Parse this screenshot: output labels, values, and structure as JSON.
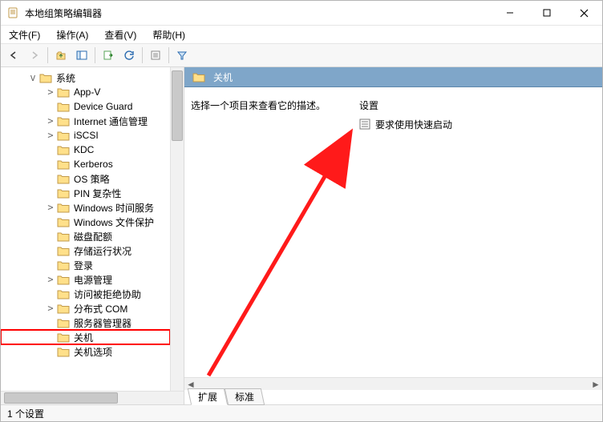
{
  "window": {
    "title": "本地组策略编辑器"
  },
  "menus": {
    "file": "文件(F)",
    "action": "操作(A)",
    "view": "查看(V)",
    "help": "帮助(H)"
  },
  "tree": {
    "root": "系统",
    "items": [
      {
        "label": "App-V",
        "expandable": true
      },
      {
        "label": "Device Guard",
        "expandable": false
      },
      {
        "label": "Internet 通信管理",
        "expandable": true
      },
      {
        "label": "iSCSI",
        "expandable": true
      },
      {
        "label": "KDC",
        "expandable": false
      },
      {
        "label": "Kerberos",
        "expandable": false
      },
      {
        "label": "OS 策略",
        "expandable": false
      },
      {
        "label": "PIN 复杂性",
        "expandable": false
      },
      {
        "label": "Windows 时间服务",
        "expandable": true
      },
      {
        "label": "Windows 文件保护",
        "expandable": false
      },
      {
        "label": "磁盘配额",
        "expandable": false
      },
      {
        "label": "存储运行状况",
        "expandable": false
      },
      {
        "label": "登录",
        "expandable": false
      },
      {
        "label": "电源管理",
        "expandable": true
      },
      {
        "label": "访问被拒绝协助",
        "expandable": false
      },
      {
        "label": "分布式 COM",
        "expandable": true
      },
      {
        "label": "服务器管理器",
        "expandable": false
      },
      {
        "label": "关机",
        "expandable": false,
        "selected": true
      },
      {
        "label": "关机选项",
        "expandable": false
      }
    ]
  },
  "right": {
    "header": "关机",
    "description": "选择一个项目来查看它的描述。",
    "column_header": "设置",
    "settings": [
      {
        "label": "要求使用快速启动"
      }
    ],
    "tabs": {
      "extended": "扩展",
      "standard": "标准"
    }
  },
  "status": {
    "text": "1 个设置"
  }
}
